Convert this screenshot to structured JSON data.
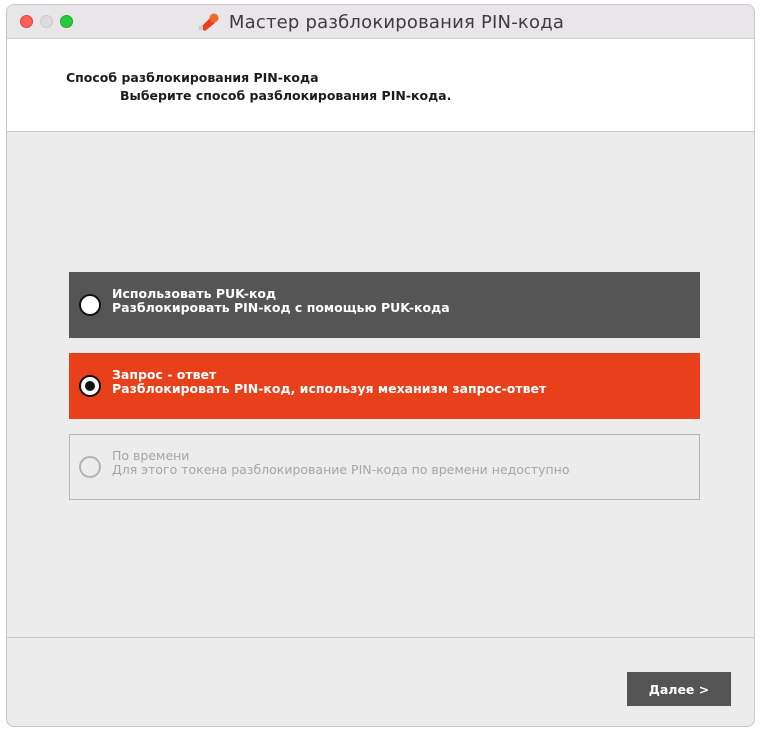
{
  "window": {
    "title": "Мастер разблокирования PIN-кода",
    "title_icon": "key-icon"
  },
  "header": {
    "title": "Способ разблокирования PIN-кода",
    "subtitle": "Выберите способ разблокирования PIN-кода."
  },
  "options": [
    {
      "title": "Использовать PUK-код",
      "description": "Разблокировать PIN-код с помощью PUK-кода",
      "selected": false,
      "enabled": true,
      "color": "#555555"
    },
    {
      "title": "Запрос - ответ",
      "description": "Разблокировать PIN-код, используя механизм запрос-ответ",
      "selected": true,
      "enabled": true,
      "color": "#e8401b"
    },
    {
      "title": "По времени",
      "description": "Для этого токена разблокирование PIN-кода по времени недоступно",
      "selected": false,
      "enabled": false,
      "color": "#a6a6a6"
    }
  ],
  "footer": {
    "next_label": "Далее >"
  }
}
